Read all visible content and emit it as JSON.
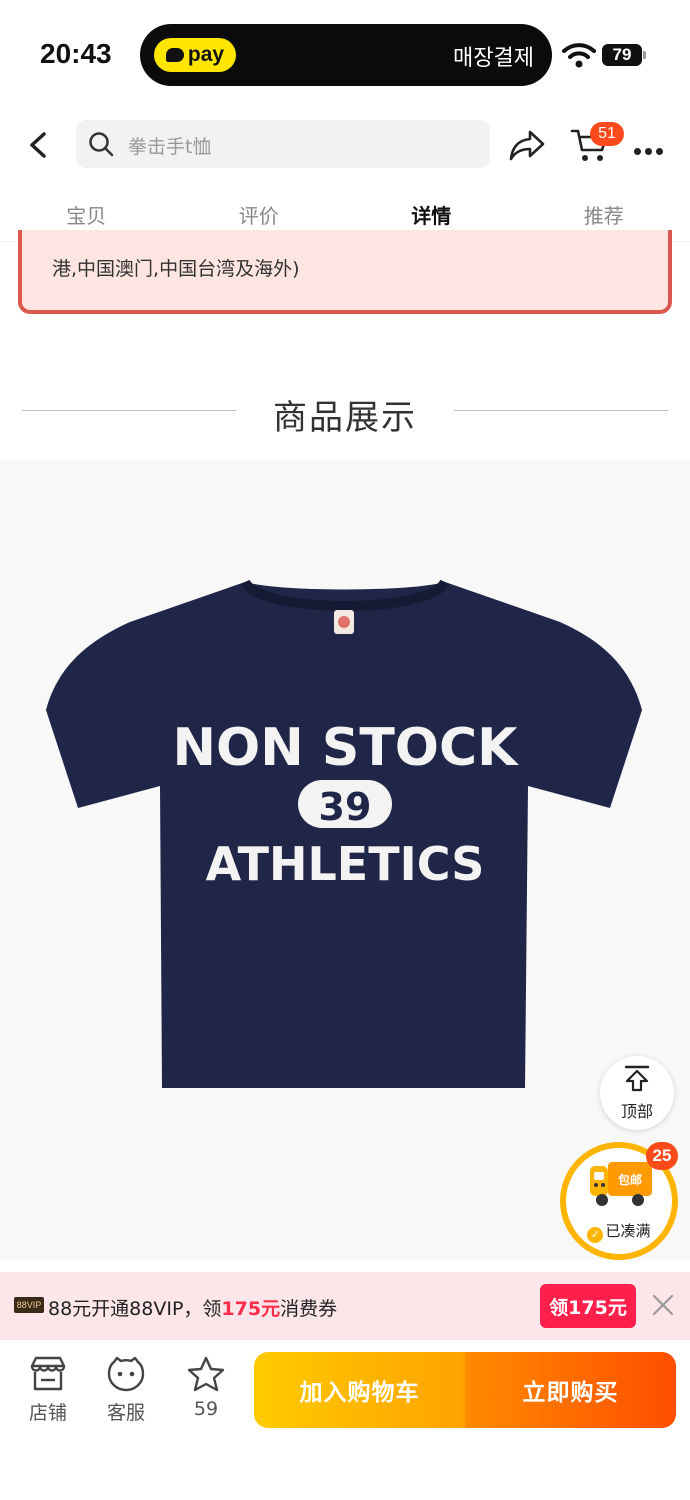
{
  "status_bar": {
    "time": "20:43",
    "pay_label": "pay",
    "korean_label": "매장결제",
    "battery": "79"
  },
  "nav": {
    "search_placeholder": "拳击手t恤",
    "cart_count": "51"
  },
  "tabs": [
    {
      "label": "宝贝",
      "active": false
    },
    {
      "label": "评价",
      "active": false
    },
    {
      "label": "详情",
      "active": true
    },
    {
      "label": "推荐",
      "active": false
    }
  ],
  "notice": {
    "text": "港,中国澳门,中国台湾及海外)"
  },
  "section": {
    "title": "商品展示"
  },
  "product_print": {
    "line1": "NON STOCK",
    "number": "39",
    "line2": "ATHLETICS"
  },
  "floating": {
    "top_label": "顶部",
    "ship_count": "25",
    "ship_text": "包邮",
    "ship_label": "已凑满"
  },
  "vip": {
    "tag": "88VIP",
    "text_prefix": "88元开通88VIP，领",
    "text_amount": "175元",
    "text_suffix": "消费券",
    "button": "领175元"
  },
  "bottom": {
    "store_label": "店铺",
    "service_label": "客服",
    "fav_count": "59",
    "add_cart": "加入购物车",
    "buy_now": "立即购买"
  },
  "colors": {
    "accent_orange": "#ff4e00",
    "accent_yellow": "#ffb400",
    "vip_red": "#ff1f4b",
    "shirt_navy": "#1f2647"
  }
}
